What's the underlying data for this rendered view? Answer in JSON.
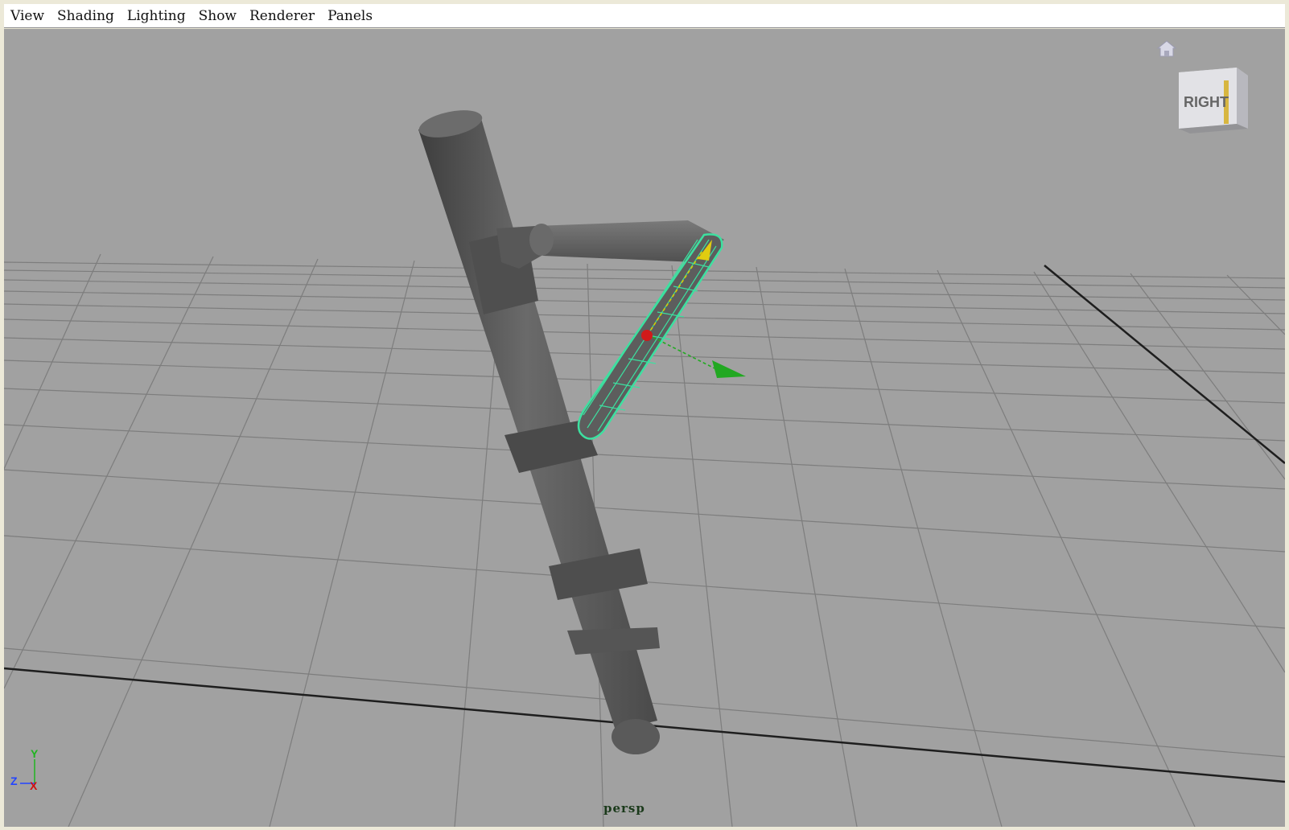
{
  "menubar": {
    "items": [
      "View",
      "Shading",
      "Lighting",
      "Show",
      "Renderer",
      "Panels"
    ]
  },
  "viewport": {
    "camera_label": "persp",
    "background_color": "#a1a1a1",
    "grid_color": "#7a7a7a",
    "selection_color": "#3de0a0"
  },
  "viewcube": {
    "face_label": "RIGHT",
    "home_icon": "home-icon"
  },
  "axis_indicator": {
    "y_label": "Y",
    "z_label": "Z",
    "x_label": "X"
  }
}
